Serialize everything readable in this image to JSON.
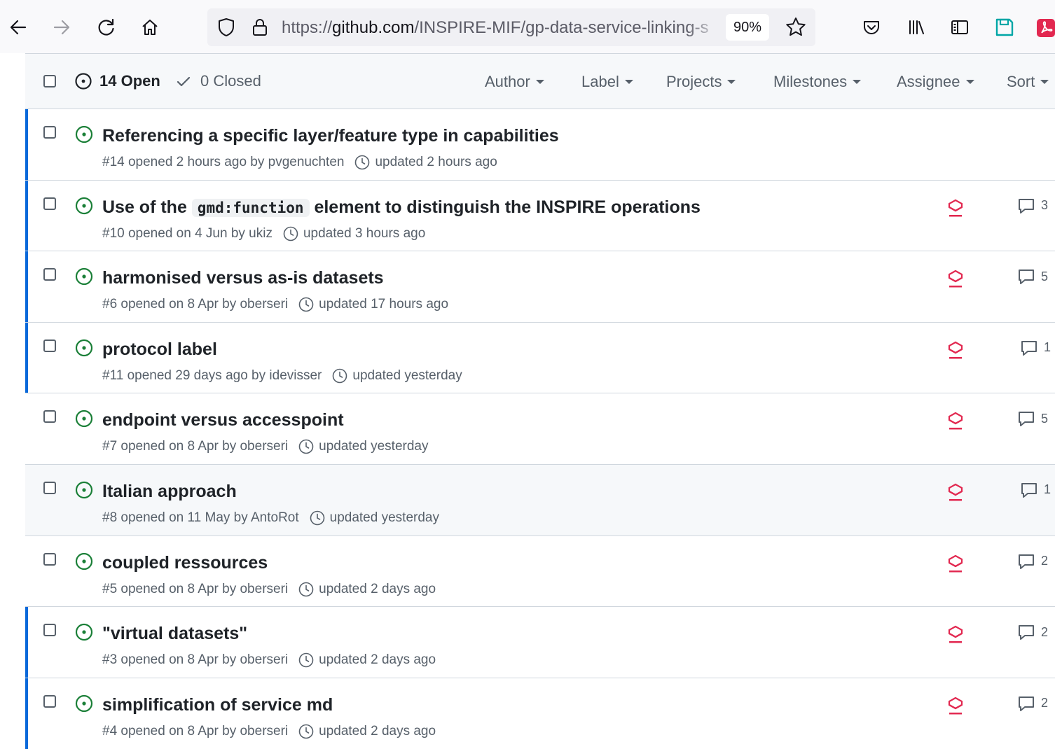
{
  "browser": {
    "url_prefix": "https://",
    "url_host": "github.com",
    "url_path": "/INSPIRE-MIF/gp-data-service-linking-s",
    "zoom": "90%",
    "accent_color": "#e22850"
  },
  "header": {
    "open_label": "14 Open",
    "closed_label": "0 Closed",
    "filters": {
      "author": "Author",
      "label": "Label",
      "projects": "Projects",
      "milestones": "Milestones",
      "assignee": "Assignee",
      "sort": "Sort"
    }
  },
  "issues": [
    {
      "title": "Referencing a specific layer/feature type in capabilities",
      "opened": "#14 opened 2 hours ago by pvgenuchten",
      "updated": "updated 2 hours ago",
      "comments": ""
    },
    {
      "title_pre": "Use of the ",
      "title_code": "gmd:function",
      "title_post": " element to distinguish the INSPIRE operations",
      "opened": "#10 opened on 4 Jun by ukiz",
      "updated": "updated 3 hours ago",
      "comments": "3"
    },
    {
      "title": "harmonised versus as-is datasets",
      "opened": "#6 opened on 8 Apr by oberseri",
      "updated": "updated 17 hours ago",
      "comments": "5"
    },
    {
      "title": "protocol label",
      "opened": "#11 opened 29 days ago by idevisser",
      "updated": "updated yesterday",
      "comments": "1"
    },
    {
      "title": "endpoint versus accesspoint",
      "opened": "#7 opened on 8 Apr by oberseri",
      "updated": "updated yesterday",
      "comments": "5"
    },
    {
      "title": "Italian approach",
      "opened": "#8 opened on 11 May by AntoRot",
      "updated": "updated yesterday",
      "comments": "1"
    },
    {
      "title": "coupled ressources",
      "opened": "#5 opened on 8 Apr by oberseri",
      "updated": "updated 2 days ago",
      "comments": "2"
    },
    {
      "title": "\"virtual datasets\"",
      "opened": "#3 opened on 8 Apr by oberseri",
      "updated": "updated 2 days ago",
      "comments": "2"
    },
    {
      "title": "simplification of service md",
      "opened": "#4 opened on 8 Apr by oberseri",
      "updated": "updated 2 days ago",
      "comments": "2"
    }
  ]
}
